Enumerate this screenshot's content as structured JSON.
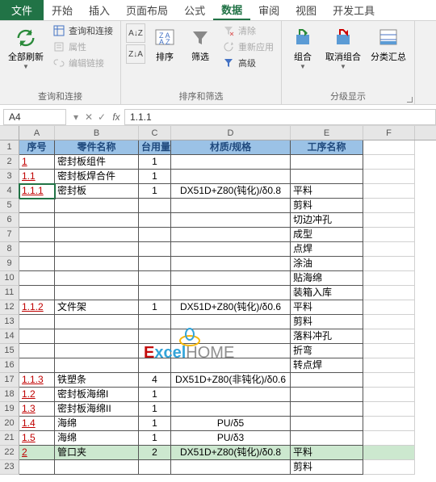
{
  "tabs": {
    "file": "文件",
    "home": "开始",
    "insert": "插入",
    "layout": "页面布局",
    "formula": "公式",
    "data": "数据",
    "review": "审阅",
    "view": "视图",
    "dev": "开发工具"
  },
  "ribbon": {
    "conn": {
      "refresh": "全部刷新",
      "qc": "查询和连接",
      "props": "属性",
      "links": "编辑链接",
      "label": "查询和连接"
    },
    "sort": {
      "sort": "排序",
      "filter": "筛选",
      "clear": "清除",
      "reapply": "重新应用",
      "adv": "高级",
      "label": "排序和筛选"
    },
    "outline": {
      "group": "组合",
      "ungroup": "取消组合",
      "subtotal": "分类汇总",
      "label": "分级显示"
    }
  },
  "namebox": "A4",
  "formula": "1.1.1",
  "cols": [
    "A",
    "B",
    "C",
    "D",
    "E",
    "F"
  ],
  "header": {
    "a": "序号",
    "b": "零件名称",
    "c": "台用量",
    "d": "材质/规格",
    "e": "工序名称"
  },
  "rows": [
    {
      "n": 2,
      "a": "1",
      "b": "密封板组件",
      "c": "1",
      "d": "",
      "e": "",
      "red": true
    },
    {
      "n": 3,
      "a": "1.1",
      "b": "密封板焊合件",
      "c": "1",
      "d": "",
      "e": "",
      "red": true
    },
    {
      "n": 4,
      "a": "1.1.1",
      "b": "密封板",
      "c": "1",
      "d": "DX51D+Z80(钝化)/δ0.8",
      "e": "平料",
      "red": true,
      "active": true
    },
    {
      "n": 5,
      "a": "",
      "b": "",
      "c": "",
      "d": "",
      "e": "剪料"
    },
    {
      "n": 6,
      "a": "",
      "b": "",
      "c": "",
      "d": "",
      "e": "切边冲孔"
    },
    {
      "n": 7,
      "a": "",
      "b": "",
      "c": "",
      "d": "",
      "e": "成型"
    },
    {
      "n": 8,
      "a": "",
      "b": "",
      "c": "",
      "d": "",
      "e": "点焊"
    },
    {
      "n": 9,
      "a": "",
      "b": "",
      "c": "",
      "d": "",
      "e": "涂油"
    },
    {
      "n": 10,
      "a": "",
      "b": "",
      "c": "",
      "d": "",
      "e": "贴海绵"
    },
    {
      "n": 11,
      "a": "",
      "b": "",
      "c": "",
      "d": "",
      "e": "装箱入库"
    },
    {
      "n": 12,
      "a": "1.1.2",
      "b": "文件架",
      "c": "1",
      "d": "DX51D+Z80(钝化)/δ0.6",
      "e": "平料",
      "red": true
    },
    {
      "n": 13,
      "a": "",
      "b": "",
      "c": "",
      "d": "",
      "e": "剪料"
    },
    {
      "n": 14,
      "a": "",
      "b": "",
      "c": "",
      "d": "",
      "e": "落料冲孔"
    },
    {
      "n": 15,
      "a": "",
      "b": "",
      "c": "",
      "d": "",
      "e": "折弯"
    },
    {
      "n": 16,
      "a": "",
      "b": "",
      "c": "",
      "d": "",
      "e": "转点焊"
    },
    {
      "n": 17,
      "a": "1.1.3",
      "b": "铁塑条",
      "c": "4",
      "d": "DX51D+Z80(非钝化)/δ0.6",
      "e": "",
      "red": true
    },
    {
      "n": 18,
      "a": "1.2",
      "b": "密封板海绵I",
      "c": "1",
      "d": "",
      "e": "",
      "red": true
    },
    {
      "n": 19,
      "a": "1.3",
      "b": "密封板海绵II",
      "c": "1",
      "d": "",
      "e": "",
      "red": true
    },
    {
      "n": 20,
      "a": "1.4",
      "b": "海绵",
      "c": "1",
      "d": "PU/δ5",
      "e": "",
      "red": true
    },
    {
      "n": 21,
      "a": "1.5",
      "b": "海绵",
      "c": "1",
      "d": "PU/δ3",
      "e": "",
      "red": true
    },
    {
      "n": 22,
      "a": "2",
      "b": "管口夹",
      "c": "2",
      "d": "DX51D+Z80(钝化)/δ0.8",
      "e": "平料",
      "red": true,
      "sel": true
    },
    {
      "n": 23,
      "a": "",
      "b": "",
      "c": "",
      "d": "",
      "e": "剪料"
    }
  ],
  "logo": {
    "t1": "E",
    "t2": "xcel",
    "t3": "HOME"
  }
}
